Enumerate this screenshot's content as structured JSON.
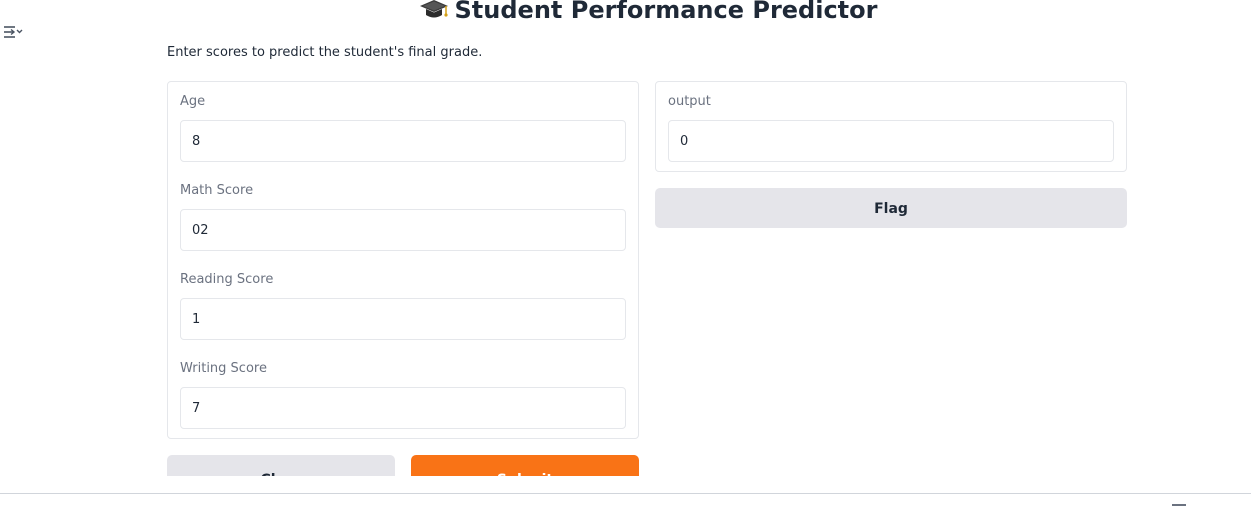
{
  "app": {
    "title": "Student Performance Predictor",
    "title_icon": "graduation-cap-icon",
    "description": "Enter scores to predict the student's final grade."
  },
  "sidebar": {
    "toggle_icon": "sidebar-toggle-icon"
  },
  "inputs": {
    "age": {
      "label": "Age",
      "value": "8"
    },
    "math": {
      "label": "Math Score",
      "value": "02"
    },
    "reading": {
      "label": "Reading Score",
      "value": "1"
    },
    "writing": {
      "label": "Writing Score",
      "value": "7"
    }
  },
  "output": {
    "label": "output",
    "value": "0"
  },
  "buttons": {
    "flag": "Flag",
    "clear": "Clear",
    "submit": "Submit"
  },
  "colors": {
    "accent": "#f97316",
    "secondary_button": "#e5e5ea",
    "border": "#e5e7eb",
    "label": "#6b7280",
    "text": "#1f2937"
  }
}
